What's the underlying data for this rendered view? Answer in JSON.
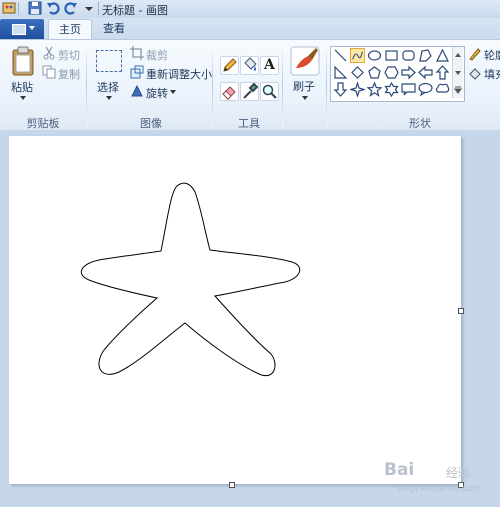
{
  "window": {
    "title": "无标题 - 画图"
  },
  "tabs": [
    {
      "label": "主页"
    },
    {
      "label": "查看"
    }
  ],
  "groups": {
    "clipboard": {
      "label": "剪贴板",
      "paste": "粘贴",
      "cut": "剪切",
      "copy": "复制"
    },
    "image": {
      "label": "图像",
      "select": "选择",
      "crop": "裁剪",
      "resize": "重新调整大小",
      "rotate": "旋转"
    },
    "tools": {
      "label": "工具",
      "text_glyph": "A"
    },
    "brushes": {
      "label": "刷子"
    },
    "shapes": {
      "label": "形状",
      "outline": "轮廓",
      "fill": "填充"
    }
  },
  "colors": {
    "accent": "#1f4f9c",
    "selected_shape": "#fde7a5",
    "canvas": "#ffffff",
    "workspace": "#c6d7ea"
  },
  "watermark": {
    "brand": "Bai",
    "brand2": "经验",
    "url": "jingyan.baidu.com"
  }
}
